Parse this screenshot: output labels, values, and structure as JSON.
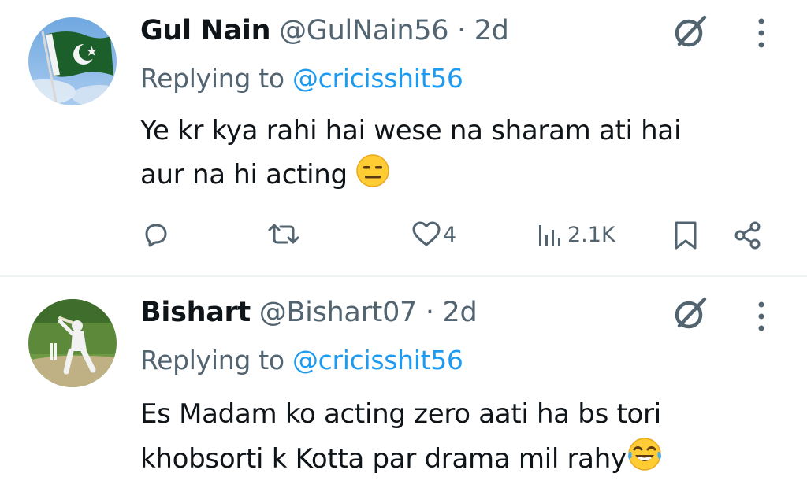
{
  "tweets": [
    {
      "name": "Gul Nain",
      "handle": "@GulNain56",
      "separator": "·",
      "time": "2d",
      "replying_prefix": "Replying to ",
      "replying_to": "@cricisshit56",
      "body_lines": [
        "Ye kr kya rahi hai wese na sharam ati hai",
        "aur na hi acting"
      ],
      "body_emoji": "expressionless-face-emoji",
      "actions": {
        "reply_count": "",
        "retweet_count": "",
        "like_count": "4",
        "views_count": "2.1K"
      },
      "avatar": "pakistan-flag"
    },
    {
      "name": "Bishart",
      "handle": "@Bishart07",
      "separator": "·",
      "time": "2d",
      "replying_prefix": "Replying to ",
      "replying_to": "@cricisshit56",
      "body_lines": [
        "Es Madam ko acting zero aati ha bs tori",
        "khobsorti k Kotta par drama mil rahy"
      ],
      "body_emoji": "face-with-tears-of-joy-emoji",
      "avatar": "cricket-batsman-photo"
    }
  ],
  "colors": {
    "text": "#0f1419",
    "secondary": "#536471",
    "link": "#1d9bf0",
    "divider": "#eff3f4"
  }
}
